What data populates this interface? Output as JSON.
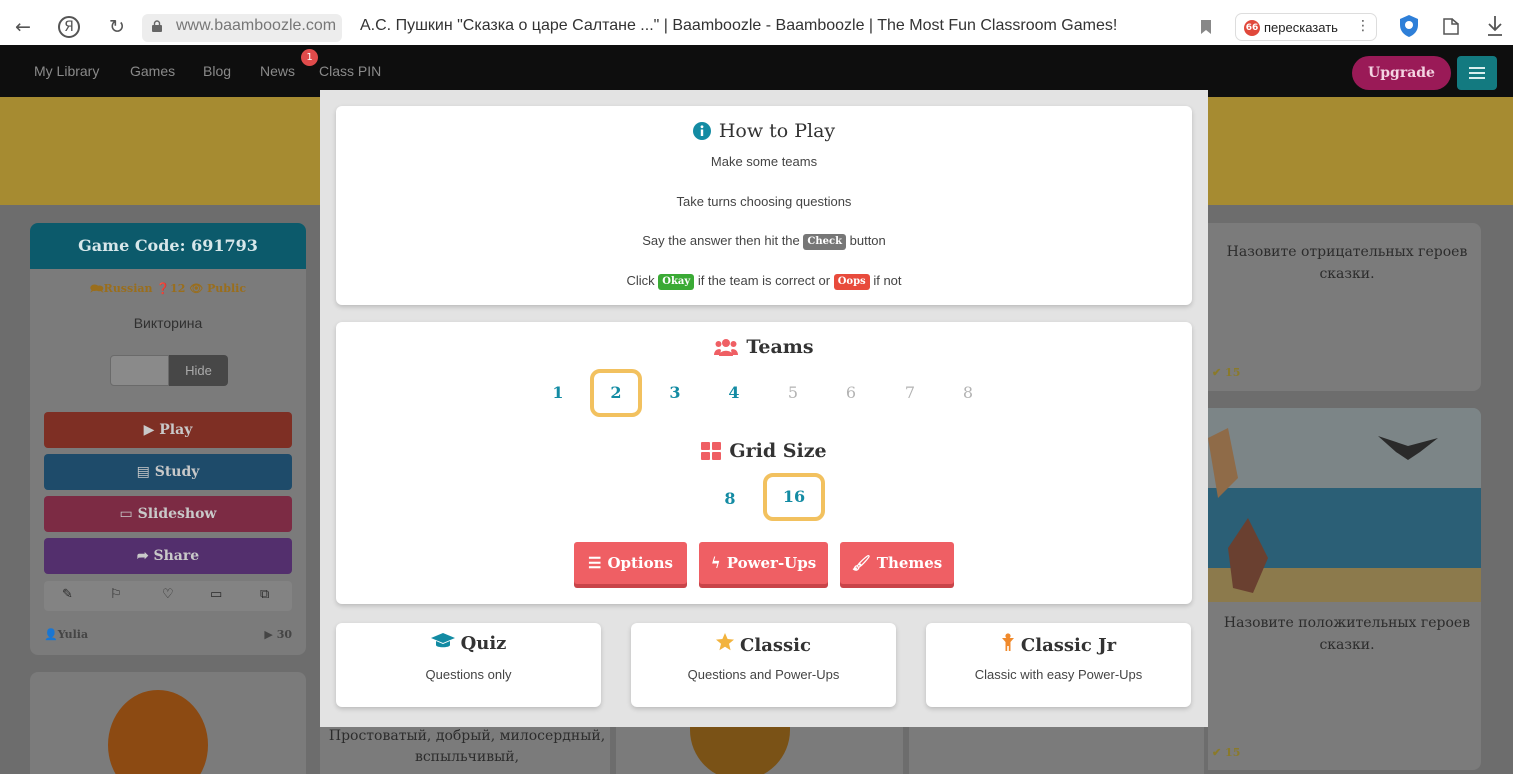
{
  "browser": {
    "url": "www.baamboozle.com",
    "tab_title": "А.С. Пушкин \"Сказка о царе Салтане ...\" | Baamboozle - Baamboozle | The Most Fun Classroom Games!",
    "retell_label": "пересказать",
    "retell_badge": "66"
  },
  "site_nav": {
    "links": [
      "My Library",
      "Games",
      "Blog",
      "News",
      "Class PIN"
    ],
    "news_badge": "1",
    "upgrade_label": "Upgrade",
    "brand_color": "#9a1a57"
  },
  "game_card": {
    "code_label": "Game Code: 691793",
    "language": "Russian",
    "questions": "12",
    "visibility": "Public",
    "subtitle": "Викторина",
    "hide_label": "Hide",
    "buttons": {
      "play": "Play",
      "study": "Study",
      "slideshow": "Slideshow",
      "share": "Share"
    },
    "author": "Yulia",
    "plays": "30"
  },
  "background_cards": {
    "right_top_text": "Назовите отрицательных героев сказки.",
    "right_top_count": "15",
    "right_bottom_text": "Назовите положительных героев сказки.",
    "right_bottom_count": "15",
    "middle_text": "Простоватый, добрый, милосердный, вспыльчивый,"
  },
  "how_to_play": {
    "title": "How to Play",
    "line1": "Make some teams",
    "line2": "Take turns choosing questions",
    "line3_before": "Say the answer then hit the",
    "line3_pill": "Check",
    "line3_after": "button",
    "line4_before": "Click",
    "line4_pill1": "Okay",
    "line4_mid": "if the team is correct or",
    "line4_pill2": "Oops",
    "line4_after": "if not"
  },
  "teams": {
    "title": "Teams",
    "options": [
      "1",
      "2",
      "3",
      "4",
      "5",
      "6",
      "7",
      "8"
    ],
    "selected": "2"
  },
  "grid_size": {
    "title": "Grid Size",
    "options": [
      "8",
      "16"
    ],
    "selected": "16"
  },
  "settings_buttons": {
    "options": "Options",
    "powerups": "Power-Ups",
    "themes": "Themes"
  },
  "modes": [
    {
      "title": "Quiz",
      "desc": "Questions only",
      "icon": "graduation-cap-icon"
    },
    {
      "title": "Classic",
      "desc": "Questions and Power-Ups",
      "icon": "star-icon"
    },
    {
      "title": "Classic Jr",
      "desc": "Classic with easy Power-Ups",
      "icon": "child-icon"
    }
  ],
  "colors": {
    "accent_teal": "#138ba3",
    "selected_border": "#f2c15f",
    "action_red": "#ef5f64"
  }
}
